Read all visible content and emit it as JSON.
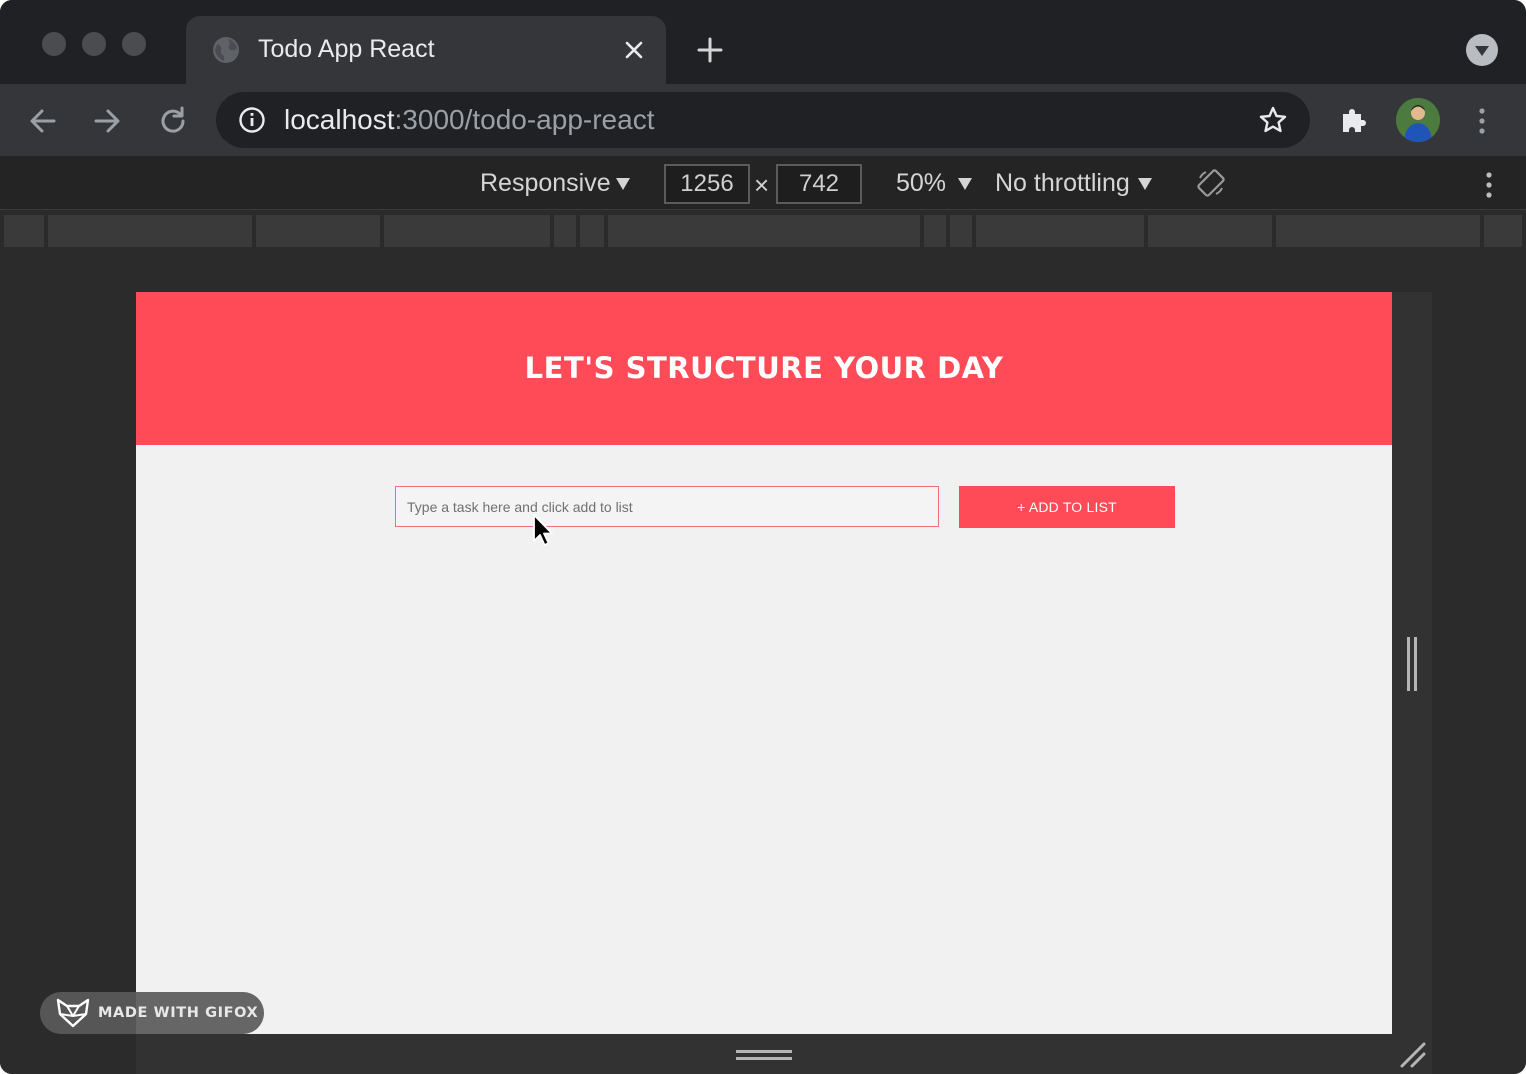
{
  "browser": {
    "tab_title": "Todo App React",
    "url_host": "localhost",
    "url_path": ":3000/todo-app-react"
  },
  "device_toolbar": {
    "device": "Responsive",
    "width": "1256",
    "height": "742",
    "zoom": "50%",
    "throttling": "No throttling"
  },
  "app": {
    "heading": "LET'S STRUCTURE YOUR DAY",
    "input_placeholder": "Type a task here and click add to list",
    "input_value": "",
    "add_button_label": "+ ADD TO LIST"
  },
  "watermark": {
    "label": "MADE WITH GIFOX"
  },
  "colors": {
    "accent": "#ff4a57",
    "page_bg": "#f1f1f1",
    "chrome_dark": "#202124"
  }
}
